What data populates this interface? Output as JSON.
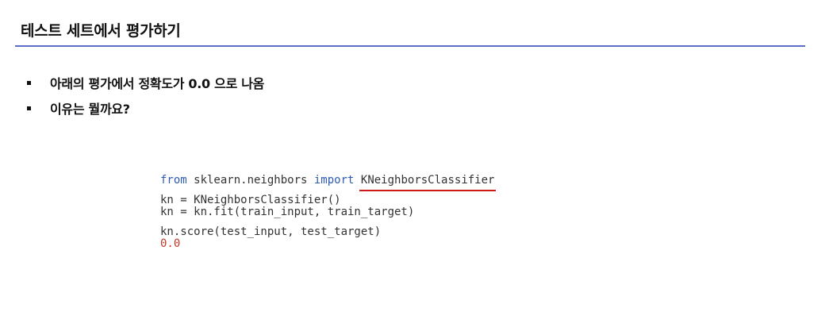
{
  "slide": {
    "title": "테스트 세트에서 평가하기"
  },
  "bullets": [
    {
      "text": "아래의 평가에서 정확도가 0.0 으로 나옴"
    },
    {
      "text": "이유는 뭘까요?"
    }
  ],
  "code": {
    "line1": {
      "kw_from": "from",
      "module": " sklearn.neighbors ",
      "kw_import": "import",
      "space": " ",
      "class_name": "KNeighborsClassifier"
    },
    "line2": "kn = KNeighborsClassifier()",
    "line3": "kn = kn.fit(train_input, train_target)",
    "line4": "kn.score(test_input, test_target)",
    "output": "0.0"
  },
  "colors": {
    "title_rule": "#5b6ec8",
    "keyword": "#2f5bb5",
    "output": "#c0392b",
    "underline": "#cc1a1a"
  }
}
